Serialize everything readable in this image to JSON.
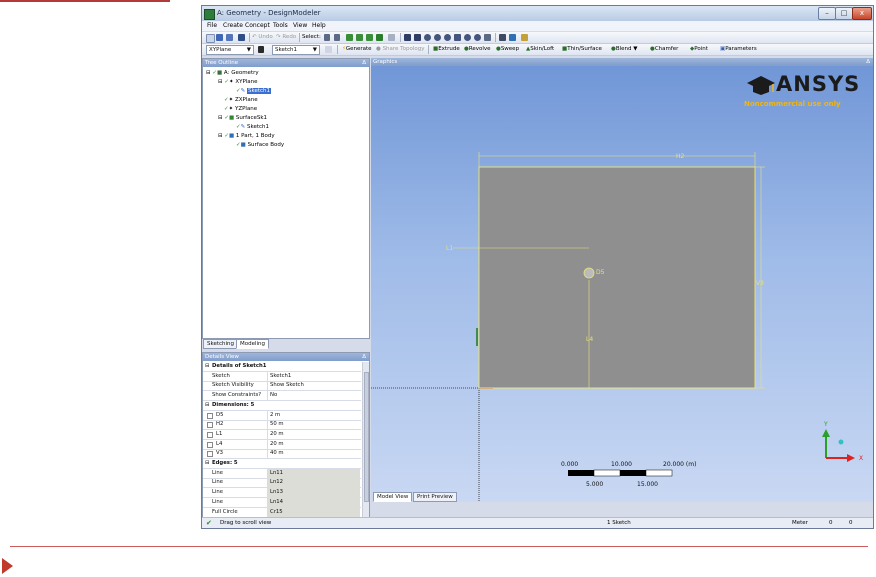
{
  "window": {
    "title": "A: Geometry - DesignModeler",
    "min_icon": "minimize-icon",
    "max_icon": "maximize-icon",
    "close_label": "x"
  },
  "menu": [
    "File",
    "Create",
    "Concept",
    "Tools",
    "View",
    "Help"
  ],
  "toolbar1": {
    "undo": "Undo",
    "redo": "Redo",
    "select": "Select:"
  },
  "toolbar2": {
    "plane": "XYPlane",
    "sketch": "Sketch1",
    "generate": "Generate",
    "share_topology": "Share Topology",
    "extrude": "Extrude",
    "revolve": "Revolve",
    "sweep": "Sweep",
    "skin_loft": "Skin/Loft",
    "thin_surface": "Thin/Surface",
    "blend": "Blend",
    "chamfer": "Chamfer",
    "point": "Point",
    "parameters": "Parameters"
  },
  "tree": {
    "header": "Tree Outline",
    "pin": "Δ",
    "items": [
      {
        "label": "A: Geometry",
        "level": 0
      },
      {
        "label": "XYPlane",
        "level": 1
      },
      {
        "label": "Sketch1",
        "level": 2,
        "selected": true
      },
      {
        "label": "ZXPlane",
        "level": 1
      },
      {
        "label": "YZPlane",
        "level": 1
      },
      {
        "label": "SurfaceSk1",
        "level": 1
      },
      {
        "label": "Sketch1",
        "level": 2
      },
      {
        "label": "1 Part, 1 Body",
        "level": 1
      },
      {
        "label": "Surface Body",
        "level": 2
      }
    ]
  },
  "tabs": {
    "sketching": "Sketching",
    "modeling": "Modeling"
  },
  "details": {
    "header": "Details View",
    "pin": "Δ",
    "rows": [
      {
        "k": "Details of Sketch1",
        "v": "",
        "type": "section"
      },
      {
        "k": "Sketch",
        "v": "Sketch1"
      },
      {
        "k": "Sketch Visibility",
        "v": "Show Sketch"
      },
      {
        "k": "Show Constraints?",
        "v": "No"
      },
      {
        "k": "Dimensions: 5",
        "v": "",
        "type": "section"
      },
      {
        "k": "D5",
        "v": "2 m",
        "check": true
      },
      {
        "k": "H2",
        "v": "50 m",
        "check": true
      },
      {
        "k": "L1",
        "v": "20 m",
        "check": true
      },
      {
        "k": "L4",
        "v": "20 m",
        "check": true
      },
      {
        "k": "V3",
        "v": "40 m",
        "check": true
      },
      {
        "k": "Edges: 5",
        "v": "",
        "type": "section"
      },
      {
        "k": "Line",
        "v": "Ln11",
        "shade": true
      },
      {
        "k": "Line",
        "v": "Ln12",
        "shade": true
      },
      {
        "k": "Line",
        "v": "Ln13",
        "shade": true
      },
      {
        "k": "Line",
        "v": "Ln14",
        "shade": true
      },
      {
        "k": "Full Circle",
        "v": "Cr15",
        "shade": true
      }
    ]
  },
  "graphics": {
    "header": "Graphics",
    "pin": "Δ",
    "logo_text": "ANSYS",
    "logo_subtitle": "Noncommercial use only",
    "dims": {
      "h2": "H2",
      "v3": "V3",
      "l1": "L1",
      "l4": "L4",
      "d5": "D5"
    },
    "scale": {
      "top_labels": [
        "0.000",
        "10.000",
        "20.000 (m)"
      ],
      "bottom_labels": [
        "5.000",
        "15.000"
      ]
    },
    "axes": {
      "x": "X",
      "y": "Y"
    },
    "tabs": {
      "model": "Model View",
      "print": "Print Preview"
    }
  },
  "status": {
    "message": "Drag to scroll view",
    "selection": "1 Sketch",
    "units": "Meter",
    "v1": "0",
    "v2": "0"
  },
  "colors": {
    "sketch_line": "#e8e27a",
    "rect_fill": "#8f8f8f",
    "panel_header": "#8aa5d2",
    "ansys_yellow": "#f2b40e"
  }
}
